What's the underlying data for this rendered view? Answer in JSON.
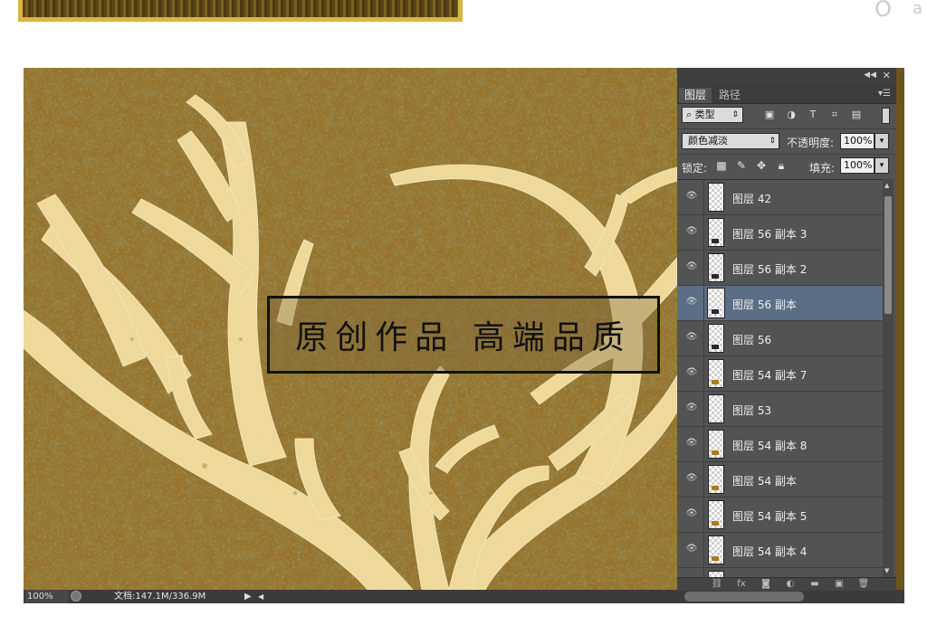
{
  "canvas": {
    "overlay_text": "原创作品 高端品质"
  },
  "background_glyphs": [
    "O",
    "a"
  ],
  "status_bar": {
    "zoom": "100%",
    "document_info": "文档:147.1M/336.9M"
  },
  "layers_panel": {
    "tabs": [
      {
        "label": "图层",
        "active": true
      },
      {
        "label": "路径",
        "active": false
      }
    ],
    "filter": {
      "kind_label": "类型",
      "icons": [
        "image-filter-icon",
        "adjustment-filter-icon",
        "text-filter-icon",
        "shape-filter-icon",
        "smart-object-filter-icon"
      ]
    },
    "blend_mode": "颜色减淡",
    "opacity_label": "不透明度:",
    "opacity_value": "100%",
    "lock_label": "锁定:",
    "fill_label": "填充:",
    "fill_value": "100%",
    "layers": [
      {
        "name": "图层 42",
        "visible": true,
        "selected": false
      },
      {
        "name": "图层 56 副本 3",
        "visible": true,
        "selected": false
      },
      {
        "name": "图层 56 副本 2",
        "visible": true,
        "selected": false
      },
      {
        "name": "图层 56 副本",
        "visible": true,
        "selected": true
      },
      {
        "name": "图层 56",
        "visible": true,
        "selected": false
      },
      {
        "name": "图层 54 副本 7",
        "visible": true,
        "selected": false
      },
      {
        "name": "图层 53",
        "visible": true,
        "selected": false
      },
      {
        "name": "图层 54 副本 8",
        "visible": true,
        "selected": false
      },
      {
        "name": "图层 54 副本",
        "visible": true,
        "selected": false
      },
      {
        "name": "图层 54 副本 5",
        "visible": true,
        "selected": false
      },
      {
        "name": "图层 54 副本 4",
        "visible": true,
        "selected": false
      }
    ],
    "footer_icons": [
      "link-icon",
      "fx-icon",
      "mask-icon",
      "adjustment-icon",
      "folder-icon",
      "new-layer-icon",
      "trash-icon"
    ]
  },
  "colors": {
    "panel_bg": "#535353",
    "selected_layer": "#5c6e85",
    "gold": "#c9a24a",
    "antler": "#f3dfa0"
  }
}
